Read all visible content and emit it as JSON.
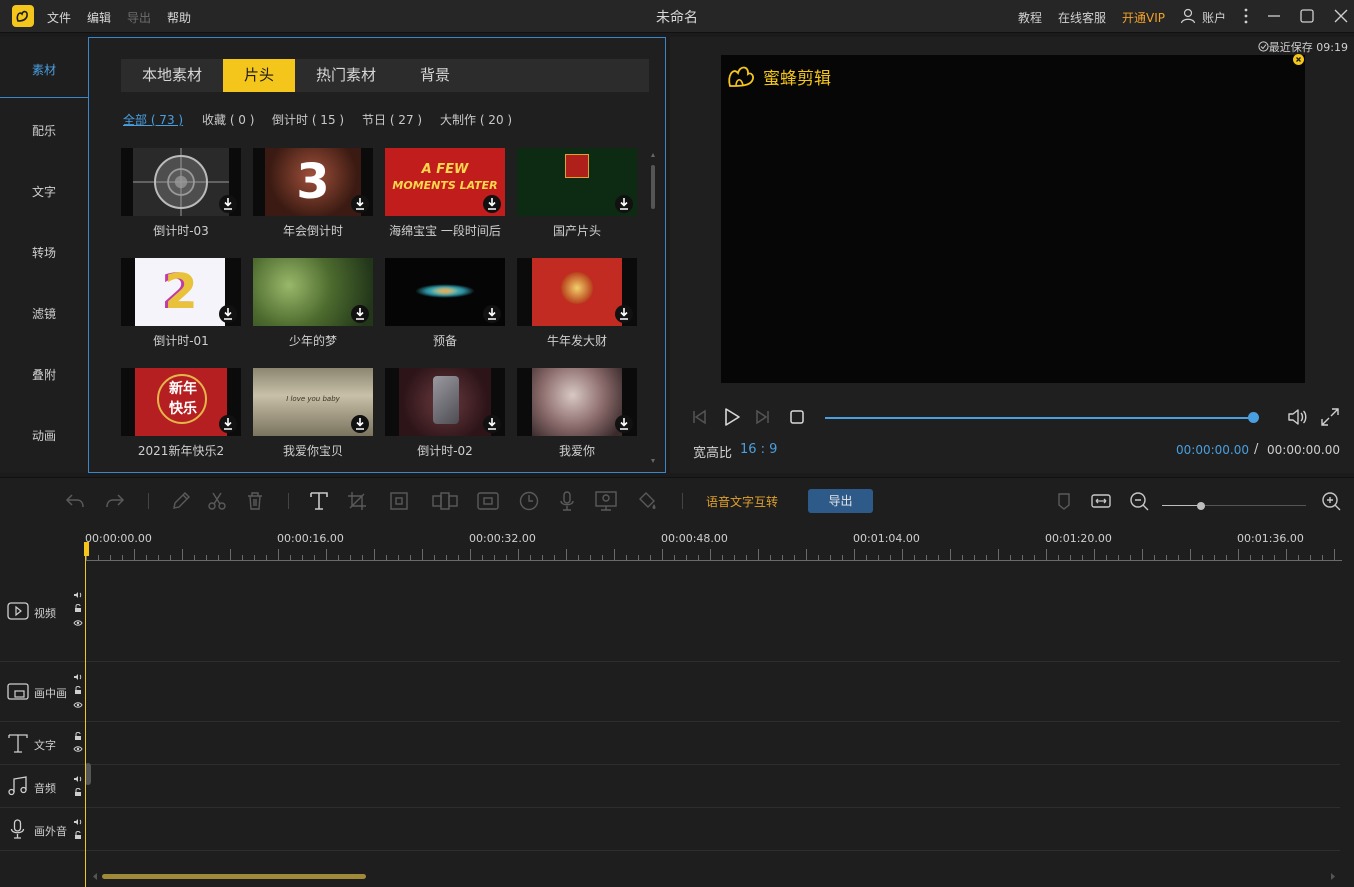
{
  "titlebar": {
    "menu": [
      "文件",
      "编辑",
      "导出",
      "帮助"
    ],
    "title": "未命名",
    "links": {
      "tutorial": "教程",
      "support": "在线客服",
      "vip": "开通VIP",
      "account": "账户"
    }
  },
  "sidenav": {
    "items": [
      "素材",
      "配乐",
      "文字",
      "转场",
      "滤镜",
      "叠附",
      "动画"
    ],
    "active_index": 0
  },
  "library": {
    "tabs": [
      "本地素材",
      "片头",
      "热门素材",
      "背景"
    ],
    "active_tab": 1,
    "filters": [
      "全部 ( 73 )",
      "收藏 ( 0 )",
      "倒计时 ( 15 )",
      "节日 ( 27 )",
      "大制作 ( 20 )"
    ],
    "active_filter": 0,
    "items": [
      {
        "label": "倒计时-03",
        "thumb": "countdown-reel"
      },
      {
        "label": "年会倒计时",
        "thumb": "number-3-gold"
      },
      {
        "label": "海绵宝宝 一段时间后",
        "thumb": "a-few-moments-later"
      },
      {
        "label": "国产片头",
        "thumb": "dragon-logo"
      },
      {
        "label": "倒计时-01",
        "thumb": "number-2-neon"
      },
      {
        "label": "少年的梦",
        "thumb": "green-leaves"
      },
      {
        "label": "预备",
        "thumb": "light-burst"
      },
      {
        "label": "牛年发大财",
        "thumb": "red-ox"
      },
      {
        "label": "2021新年快乐2",
        "thumb": "new-year-red"
      },
      {
        "label": "我爱你宝贝",
        "thumb": "paper-scroll"
      },
      {
        "label": "倒计时-02",
        "thumb": "number-3-metal"
      },
      {
        "label": "我爱你",
        "thumb": "heart-hands"
      }
    ],
    "thumb_texts": {
      "count_3": "3",
      "count_2": "2",
      "moments_1": "A FEW",
      "moments_2": "MOMENTS LATER",
      "xin": "新年",
      "kuai": "快乐",
      "scroll": "I love you baby"
    }
  },
  "preview": {
    "save_status": "最近保存 09:19",
    "brand": "蜜蜂剪辑",
    "ratio_label": "宽高比",
    "ratio_value": "16 : 9",
    "time_current": "00:00:00.00",
    "time_separator": "/",
    "time_total": "00:00:00.00",
    "progress": 1.0
  },
  "toolbar": {
    "speech_to_text": "语音文字互转",
    "export": "导出",
    "zoom_level": 0.27
  },
  "timeline": {
    "ruler": [
      "00:00:00.00",
      "00:00:16.00",
      "00:00:32.00",
      "00:00:48.00",
      "00:01:04.00",
      "00:01:20.00",
      "00:01:36.00"
    ],
    "tracks": [
      {
        "name": "视频",
        "icon": "video-track-icon"
      },
      {
        "name": "画中画",
        "icon": "pip-track-icon"
      },
      {
        "name": "文字",
        "icon": "text-track-icon"
      },
      {
        "name": "音频",
        "icon": "music-track-icon"
      },
      {
        "name": "画外音",
        "icon": "mic-track-icon"
      }
    ]
  },
  "colors": {
    "accent": "#f4c61b",
    "blue": "#4a9fe0",
    "vip": "#f0a12a",
    "bg": "#1b1b1b"
  }
}
